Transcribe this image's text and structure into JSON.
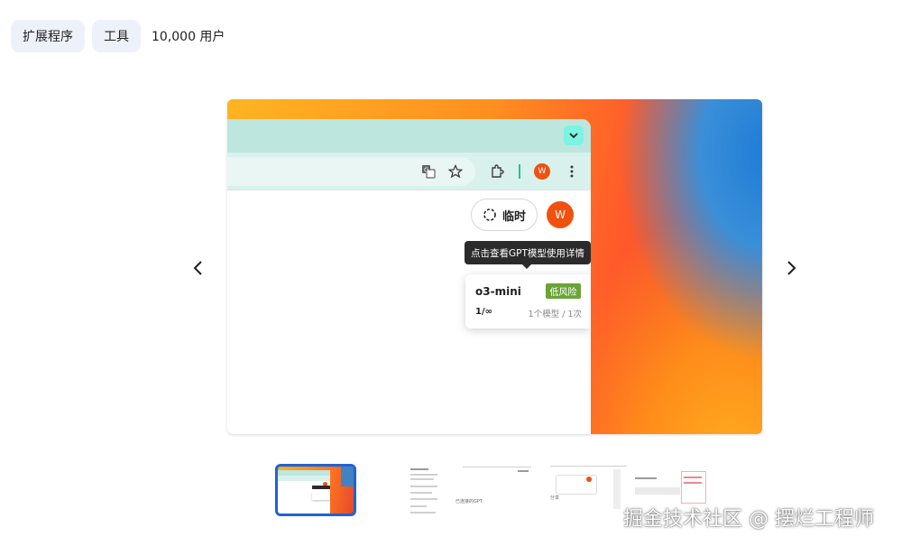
{
  "header": {
    "chips": [
      "扩展程序",
      "工具"
    ],
    "users": "10,000 用户"
  },
  "slide": {
    "temp_label": "临时",
    "avatar_letter": "W",
    "tooltip": "点击查看GPT模型使用详情",
    "model": {
      "name": "o3-mini",
      "risk_badge": "低风险",
      "usage": "1/∞",
      "meta": "1个模型 / 1次"
    }
  },
  "thumb_texts": {
    "t2_title": "已连接的GPT",
    "t3_title": "分享"
  },
  "watermark": "掘金技术社区 @ 摆烂工程师",
  "colors": {
    "accent_blue": "#1f63d6",
    "avatar_orange": "#f0510f",
    "risk_green": "#6aa436",
    "chip_bg": "#edf2fa"
  },
  "icons": {
    "prev": "chevron-left-icon",
    "next": "chevron-right-icon",
    "tab_menu": "chevron-down-icon",
    "translate": "translate-icon",
    "bookmark": "star-icon",
    "extensions": "puzzle-icon",
    "menu": "more-vert-icon",
    "temporary": "dashed-circle-icon"
  }
}
